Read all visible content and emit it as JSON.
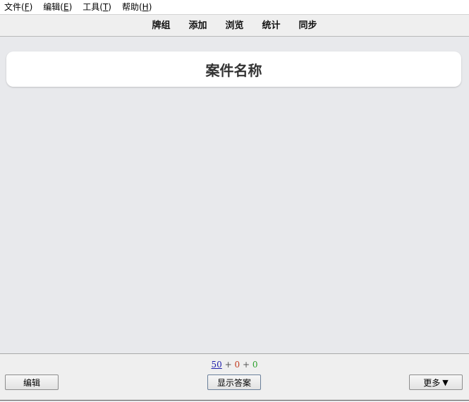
{
  "menubar": {
    "items": [
      {
        "label": "文件(",
        "key": "F",
        "suffix": ")"
      },
      {
        "label": "编辑(",
        "key": "E",
        "suffix": ")"
      },
      {
        "label": "工具(",
        "key": "T",
        "suffix": ")"
      },
      {
        "label": "帮助(",
        "key": "H",
        "suffix": ")"
      }
    ]
  },
  "toolbar": {
    "items": [
      "牌组",
      "添加",
      "浏览",
      "统计",
      "同步"
    ]
  },
  "card": {
    "title": "案件名称"
  },
  "counts": {
    "new": "50",
    "separator": "+",
    "learn": "0",
    "review": "0"
  },
  "buttons": {
    "edit": "编辑",
    "show_answer": "显示答案",
    "more": "更多",
    "more_arrow": "▼"
  },
  "colors": {
    "new_count": "#1d1dab",
    "learn_count": "#c33a1e",
    "review_count": "#2aa02a",
    "background": "#e8e9ec"
  }
}
